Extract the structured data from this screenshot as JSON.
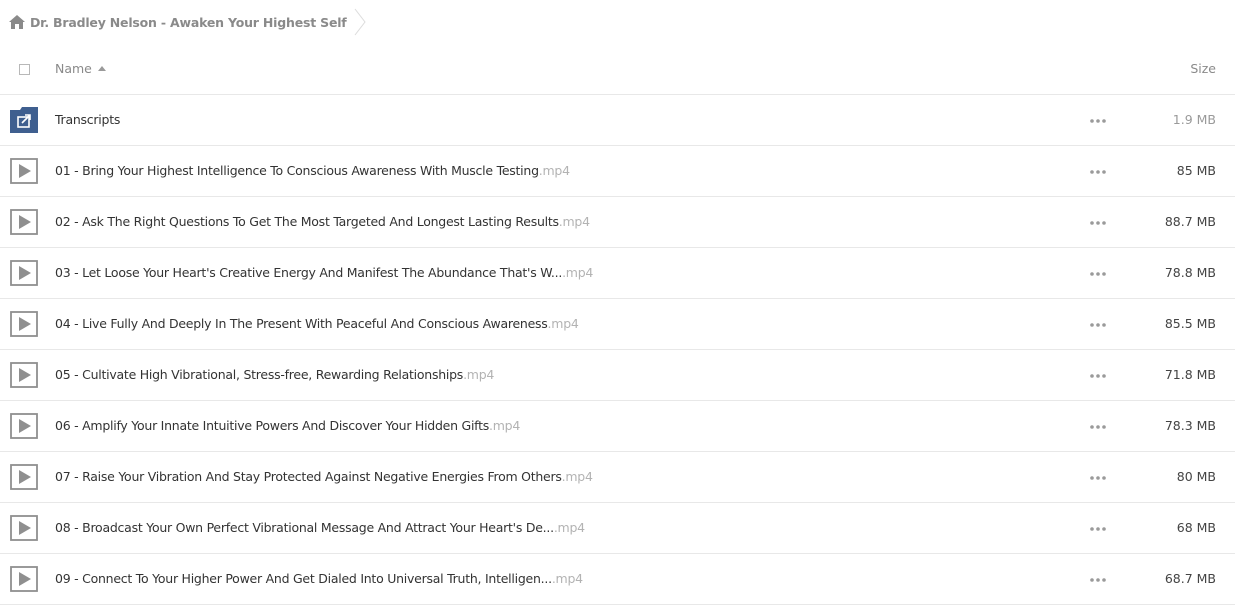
{
  "breadcrumb": {
    "title": "Dr. Bradley Nelson - Awaken Your Highest Self"
  },
  "header": {
    "name_label": "Name",
    "size_label": "Size"
  },
  "colors": {
    "folder": "#3f5f8f",
    "muted": "#9a9a9a",
    "border": "#e8e8e8"
  },
  "files": [
    {
      "type": "folder",
      "icon": "shared-folder-icon",
      "name": "Transcripts",
      "ext": "",
      "size": "1.9 MB"
    },
    {
      "type": "video",
      "icon": "video-file-icon",
      "name": "01 - Bring Your Highest Intelligence To Conscious Awareness With Muscle Testing",
      "ext": ".mp4",
      "size": "85 MB"
    },
    {
      "type": "video",
      "icon": "video-file-icon",
      "name": "02 - Ask The Right Questions To Get The Most Targeted And Longest Lasting Results",
      "ext": ".mp4",
      "size": "88.7 MB"
    },
    {
      "type": "video",
      "icon": "video-file-icon",
      "name": "03 - Let Loose Your Heart's Creative Energy And Manifest The Abundance That's W...",
      "ext": ".mp4",
      "size": "78.8 MB"
    },
    {
      "type": "video",
      "icon": "video-file-icon",
      "name": "04 - Live Fully And Deeply In The Present With Peaceful And Conscious Awareness",
      "ext": ".mp4",
      "size": "85.5 MB"
    },
    {
      "type": "video",
      "icon": "video-file-icon",
      "name": "05 - Cultivate High Vibrational, Stress-free, Rewarding Relationships",
      "ext": ".mp4",
      "size": "71.8 MB"
    },
    {
      "type": "video",
      "icon": "video-file-icon",
      "name": "06 - Amplify Your Innate Intuitive Powers And Discover Your Hidden Gifts",
      "ext": ".mp4",
      "size": "78.3 MB"
    },
    {
      "type": "video",
      "icon": "video-file-icon",
      "name": "07 - Raise Your Vibration And Stay Protected Against Negative Energies From Others",
      "ext": ".mp4",
      "size": "80 MB"
    },
    {
      "type": "video",
      "icon": "video-file-icon",
      "name": "08 - Broadcast Your Own Perfect Vibrational Message And Attract Your Heart's De...",
      "ext": ".mp4",
      "size": "68 MB"
    },
    {
      "type": "video",
      "icon": "video-file-icon",
      "name": "09 - Connect To Your Higher Power And Get Dialed Into Universal Truth, Intelligen...",
      "ext": ".mp4",
      "size": "68.7 MB"
    }
  ]
}
